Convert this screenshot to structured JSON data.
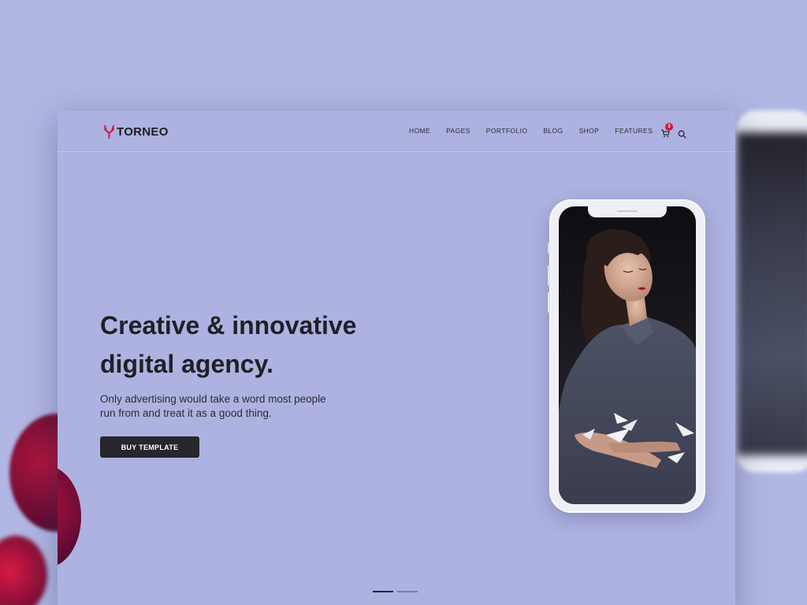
{
  "brand": {
    "name": "TORNEO",
    "icon": "antler-logo-icon",
    "accent": "#d6163f"
  },
  "nav": {
    "items": [
      "HOME",
      "PAGES",
      "PORTFOLIO",
      "BLOG",
      "SHOP",
      "FEATURES"
    ]
  },
  "cart": {
    "count": "3",
    "icon": "cart-icon"
  },
  "search": {
    "icon": "search-icon"
  },
  "hero": {
    "headline_line1": "Creative & innovative",
    "headline_line2": "digital agency.",
    "subtext_line1": "Only advertising would take a word most people",
    "subtext_line2": "run from and treat it as a good thing.",
    "button_label": "BUY TEMPLATE"
  },
  "pager": {
    "count": 2,
    "active_index": 0
  },
  "colors": {
    "background": "#b1b6e3",
    "page": "#adb2e0",
    "button": "#26262b",
    "text": "#202027"
  }
}
